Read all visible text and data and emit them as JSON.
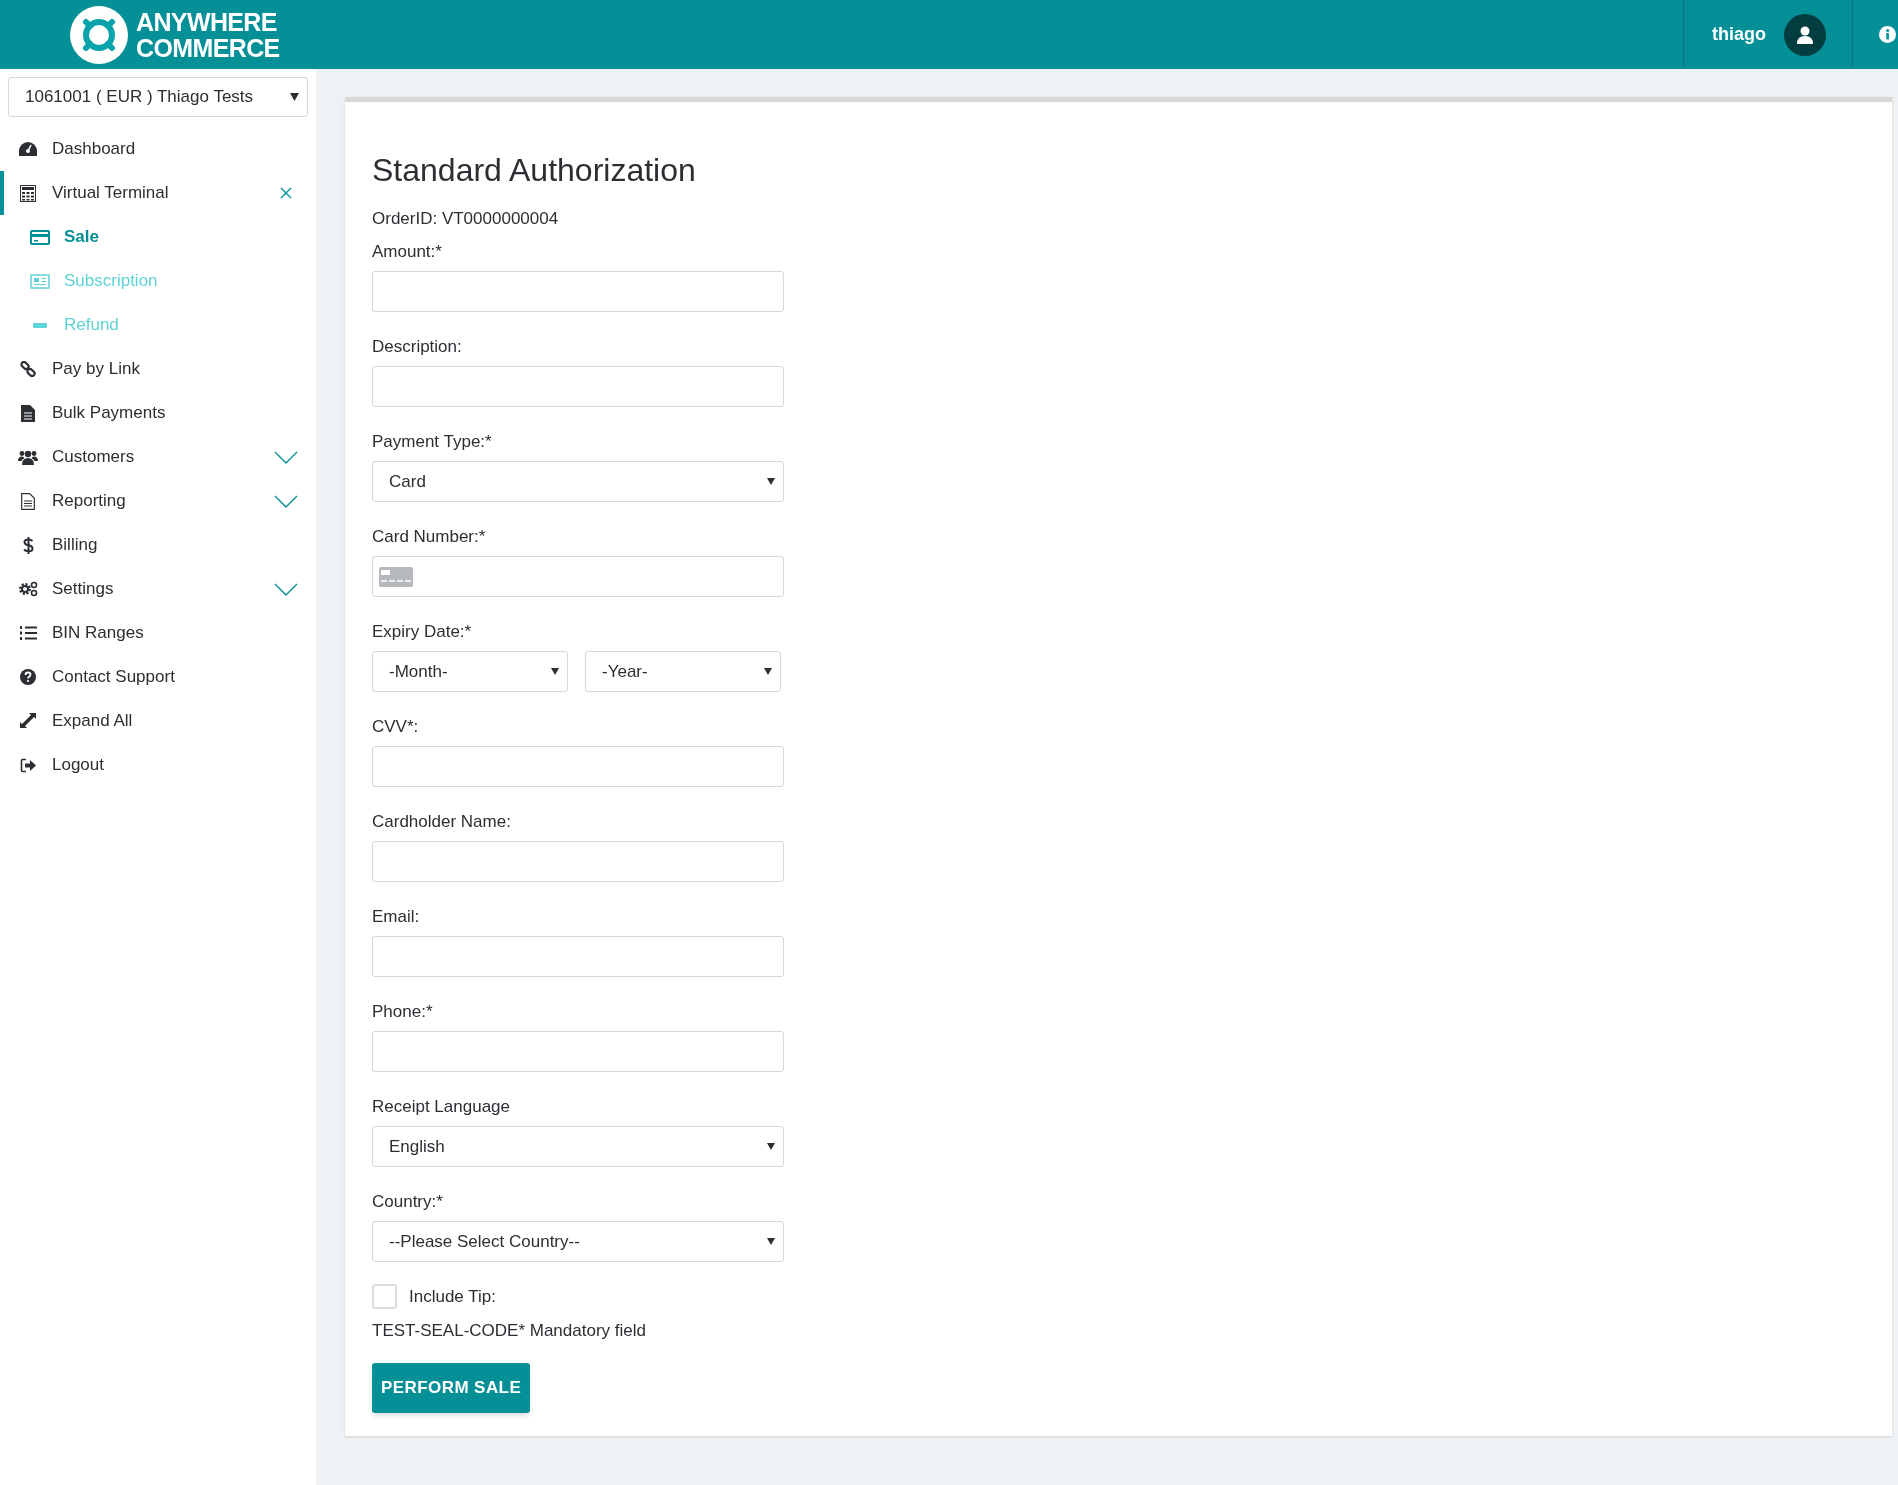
{
  "header": {
    "logo_lines": [
      "ANYWHERE",
      "COMMERCE"
    ],
    "user": "thiago"
  },
  "sidebar": {
    "account": "1061001 ( EUR ) Thiago Tests",
    "items": [
      {
        "label": "Dashboard",
        "kind": "link",
        "selected": false
      },
      {
        "label": "Virtual Terminal",
        "kind": "group",
        "selected": true,
        "expanded": true,
        "children": [
          {
            "label": "Sale",
            "selected": true
          },
          {
            "label": "Subscription",
            "selected": false
          },
          {
            "label": "Refund",
            "selected": false
          }
        ]
      },
      {
        "label": "Pay by Link",
        "kind": "link",
        "selected": false
      },
      {
        "label": "Bulk Payments",
        "kind": "link",
        "selected": false
      },
      {
        "label": "Customers",
        "kind": "group",
        "selected": false,
        "expanded": false
      },
      {
        "label": "Reporting",
        "kind": "group",
        "selected": false,
        "expanded": false
      },
      {
        "label": "Billing",
        "kind": "link",
        "selected": false
      },
      {
        "label": "Settings",
        "kind": "group",
        "selected": false,
        "expanded": false
      },
      {
        "label": "BIN Ranges",
        "kind": "link",
        "selected": false
      },
      {
        "label": "Contact Support",
        "kind": "link",
        "selected": false
      },
      {
        "label": "Expand All",
        "kind": "link",
        "selected": false
      },
      {
        "label": "Logout",
        "kind": "link",
        "selected": false
      }
    ]
  },
  "form": {
    "title": "Standard Authorization",
    "order_id": "OrderID: VT0000000004",
    "fields": [
      {
        "kind": "text",
        "label": "Amount:*"
      },
      {
        "kind": "text",
        "label": "Description:"
      },
      {
        "kind": "select",
        "label": "Payment Type:*",
        "value": "Card"
      },
      {
        "kind": "card",
        "label": "Card Number:*"
      },
      {
        "kind": "expiry",
        "label": "Expiry Date:*",
        "values": [
          "-Month-",
          "-Year-"
        ]
      },
      {
        "kind": "text",
        "label": "CVV*:"
      },
      {
        "kind": "text",
        "label": "Cardholder Name:"
      },
      {
        "kind": "text",
        "label": "Email:"
      },
      {
        "kind": "text",
        "label": "Phone:*"
      },
      {
        "kind": "select",
        "label": "Receipt Language",
        "value": "English"
      },
      {
        "kind": "select",
        "label": "Country:*",
        "value": "--Please Select Country--"
      }
    ],
    "tip": {
      "label": "Include Tip:",
      "checked": false
    },
    "note": "TEST-SEAL-CODE* Mandatory field",
    "submit": "PERFORM SALE"
  }
}
